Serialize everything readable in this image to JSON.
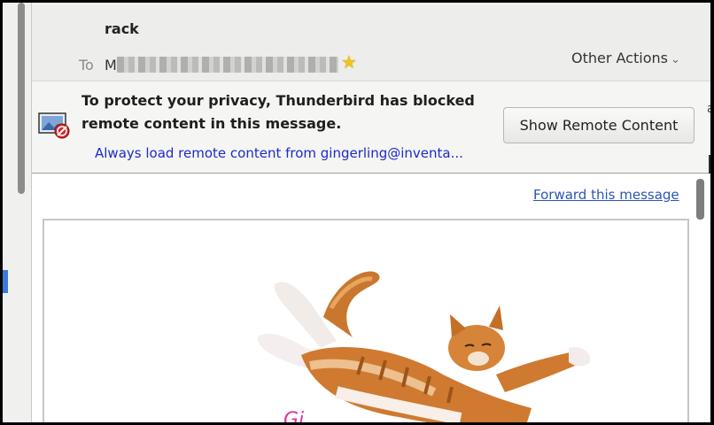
{
  "header": {
    "subject": "rack",
    "to_label": "To",
    "to_initial": "M",
    "other_actions_label": "Other Actions"
  },
  "privacy_bar": {
    "message": "To protect your privacy, Thunderbird has blocked remote content in this message.",
    "always_load_link": "Always load remote content from gingerling@inventa...",
    "show_remote_button": "Show Remote Content"
  },
  "message_body": {
    "forward_link": "Forward this message",
    "script_fragment": "Gi"
  },
  "edge_text": "a",
  "colors": {
    "link": "#1c2bc9",
    "forward_link": "#2a55b5",
    "accent": "#3b7ad5",
    "star": "#f0c419"
  },
  "icons": [
    "star-icon",
    "chevron-down-icon",
    "blocked-image-icon"
  ]
}
